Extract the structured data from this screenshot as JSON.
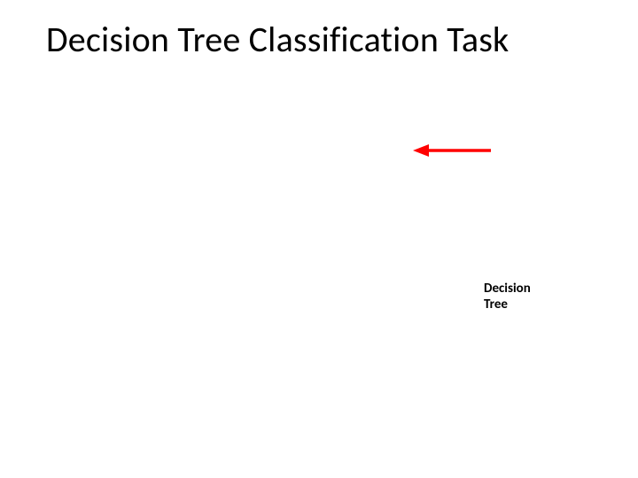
{
  "title": "Decision Tree Classification Task",
  "label": {
    "line1": "Decision",
    "line2": "Tree"
  },
  "arrow": {
    "color": "#ff0000"
  }
}
